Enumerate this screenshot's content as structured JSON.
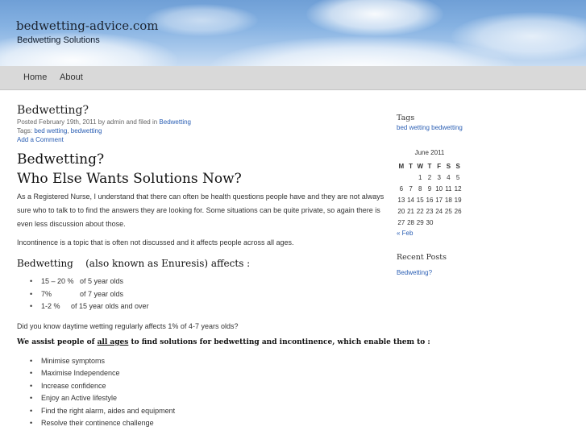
{
  "header": {
    "site_title": "bedwetting-advice.com",
    "site_description": "Bedwetting Solutions"
  },
  "nav": {
    "items": [
      "Home",
      "About"
    ]
  },
  "post": {
    "title": "Bedwetting?",
    "meta_prefix": "Posted February 19th, 2011 by admin and filed in",
    "meta_category": "Bedwetting",
    "tags_label": "Tags:",
    "tag_1": "bed wetting",
    "tag_sep": ",",
    "tag_2": "bedwetting",
    "add_comment": "Add a Comment",
    "heading_1": "Bedwetting?",
    "heading_2": "Who Else Wants Solutions Now?",
    "para_1": "As a Registered Nurse, I understand that  there can often be health questions people have and they are not always sure who to talk to to find the answers they are looking for.  Some situations can be quite private, so again there is even less discussion about those.",
    "para_2": "Incontinence is a topic that is often not discussed and it affects people across all ages.",
    "affects_heading": "Bedwetting    (also known as Enuresis) affects :",
    "affects_list": [
      {
        "pct": "15 – 20 %",
        "text": "of 5 year olds"
      },
      {
        "pct": "7%",
        "text": "of 7 year olds"
      },
      {
        "pct": "1-2 %",
        "text": "of 15 year olds and over"
      }
    ],
    "para_3": "Did you know daytime wetting regularly affects 1% of 4-7 years olds?",
    "assist_pre": "We assist people of ",
    "assist_underline": "all ages",
    "assist_post": " to find solutions for bedwetting and incontinence, which enable them to :",
    "assist_list": [
      "Minimise symptoms",
      "Maximise Independence",
      "Increase confidence",
      "Enjoy an Active lifestyle",
      "Find the right alarm, aides and equipment",
      "Resolve their continence challenge"
    ]
  },
  "sidebar": {
    "tags_heading": "Tags",
    "tags": [
      "bed wetting",
      "bedwetting"
    ],
    "calendar": {
      "caption": "June 2011",
      "days": [
        "M",
        "T",
        "W",
        "T",
        "F",
        "S",
        "S"
      ],
      "weeks": [
        [
          "",
          "",
          "1",
          "2",
          "3",
          "4",
          "5"
        ],
        [
          "6",
          "7",
          "8",
          "9",
          "10",
          "11",
          "12"
        ],
        [
          "13",
          "14",
          "15",
          "16",
          "17",
          "18",
          "19"
        ],
        [
          "20",
          "21",
          "22",
          "23",
          "24",
          "25",
          "26"
        ],
        [
          "27",
          "28",
          "29",
          "30",
          "",
          "",
          ""
        ]
      ],
      "prev_link": "« Feb"
    },
    "recent_heading": "Recent Posts",
    "recent_posts": [
      "Bedwetting?"
    ]
  }
}
